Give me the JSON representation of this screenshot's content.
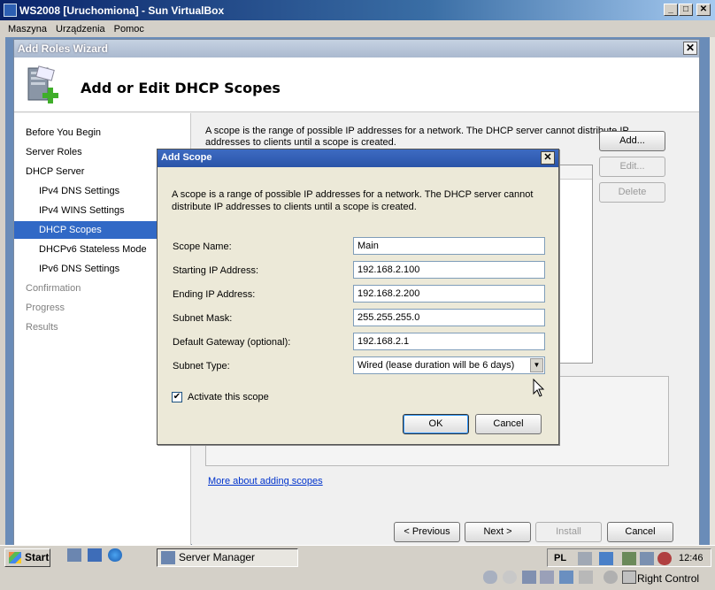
{
  "vbox": {
    "title": "WS2008 [Uruchomiona] - Sun VirtualBox",
    "menu": [
      "Maszyna",
      "Urządzenia",
      "Pomoc"
    ],
    "host_key_label": "Right Control"
  },
  "wizard": {
    "title": "Add Roles Wizard",
    "header_title": "Add or Edit DHCP Scopes",
    "nav": [
      {
        "label": "Before You Begin",
        "state": "normal",
        "indent": 0
      },
      {
        "label": "Server Roles",
        "state": "normal",
        "indent": 0
      },
      {
        "label": "DHCP Server",
        "state": "normal",
        "indent": 0
      },
      {
        "label": "IPv4 DNS Settings",
        "state": "normal",
        "indent": 1
      },
      {
        "label": "IPv4 WINS Settings",
        "state": "normal",
        "indent": 1
      },
      {
        "label": "DHCP Scopes",
        "state": "selected",
        "indent": 1
      },
      {
        "label": "DHCPv6 Stateless Mode",
        "state": "normal",
        "indent": 1
      },
      {
        "label": "IPv6 DNS Settings",
        "state": "normal",
        "indent": 1
      },
      {
        "label": "Confirmation",
        "state": "disabled",
        "indent": 0
      },
      {
        "label": "Progress",
        "state": "disabled",
        "indent": 0
      },
      {
        "label": "Results",
        "state": "disabled",
        "indent": 0
      }
    ],
    "description": "A scope is the range of possible IP addresses for a network. The DHCP server cannot distribute IP addresses to clients until a scope is created.",
    "buttons": {
      "add": "Add...",
      "edit": "Edit...",
      "delete": "Delete"
    },
    "more_link": "More about adding scopes",
    "footer": {
      "previous": "< Previous",
      "next": "Next >",
      "install": "Install",
      "cancel": "Cancel"
    }
  },
  "dialog": {
    "title": "Add Scope",
    "description": "A scope is a range of possible IP addresses for a network. The DHCP server cannot distribute IP addresses to clients until a scope is created.",
    "fields": {
      "scope_name": {
        "label": "Scope Name:",
        "value": "Main"
      },
      "start_ip": {
        "label": "Starting IP Address:",
        "value": "192.168.2.100"
      },
      "end_ip": {
        "label": "Ending IP Address:",
        "value": "192.168.2.200"
      },
      "subnet": {
        "label": "Subnet Mask:",
        "value": "255.255.255.0"
      },
      "gateway": {
        "label": "Default Gateway (optional):",
        "value": "192.168.2.1"
      },
      "subnet_type": {
        "label": "Subnet Type:",
        "value": "Wired (lease duration will be 6 days)"
      }
    },
    "activate": {
      "label": "Activate this scope",
      "checked": true
    },
    "ok": "OK",
    "cancel": "Cancel"
  },
  "taskbar": {
    "start": "Start",
    "task": "Server Manager",
    "lang": "PL",
    "clock": "12:46"
  }
}
